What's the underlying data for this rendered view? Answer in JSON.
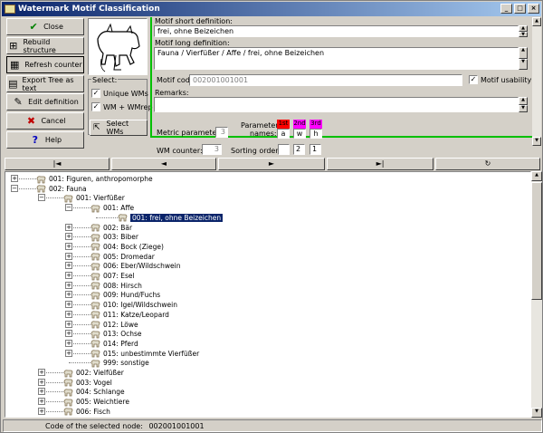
{
  "window": {
    "title": "Watermark Motif Classification"
  },
  "buttons": {
    "close": "Close",
    "rebuild": "Rebuild structure",
    "refresh": "Refresh counter",
    "export": "Export Tree as text",
    "edit": "Edit definition",
    "cancel": "Cancel",
    "help": "Help",
    "select_wms": "Select WMs"
  },
  "select_group": {
    "title": "Select:",
    "unique_wms": "Unique WMs",
    "wm_wmrep": "WM + WMrep"
  },
  "form": {
    "short_label": "Motif short definition:",
    "short_value": "frei, ohne Beizeichen",
    "long_label": "Motif long definition:",
    "long_value": "Fauna / Vierfüßer / Affe / frei, ohne Beizeichen",
    "code_label": "Motif code:",
    "code_value": "002001001001",
    "usability_label": "Motif usability",
    "remarks_label": "Remarks:",
    "metric_label": "Metric parameters:",
    "metric_value": "3",
    "param_names_label_1": "Parameter",
    "param_names_label_2": "names:",
    "wm_counter_label": "WM counter:",
    "wm_counter_value": "3",
    "sorting_label": "Sorting order:",
    "sort_1": "",
    "sort_2": "2",
    "sort_3": "1"
  },
  "params": [
    {
      "label": "1st",
      "name": "a",
      "color": "#ff0000"
    },
    {
      "label": "2nd",
      "name": "w",
      "color": "#ff00ff"
    },
    {
      "label": "3rd",
      "name": "h",
      "color": "#ff00ff"
    }
  ],
  "nav": {
    "first": "|◄",
    "prev": "◄",
    "next": "►",
    "last": "►|",
    "refresh": "↻"
  },
  "tree": [
    {
      "label": "001: Figuren, anthropomorphe",
      "level": 0,
      "exp": "+"
    },
    {
      "label": "002: Fauna",
      "level": 0,
      "exp": "-"
    },
    {
      "label": "001: Vierfüßer",
      "level": 1,
      "exp": "-"
    },
    {
      "label": "001: Affe",
      "level": 2,
      "exp": "-"
    },
    {
      "label": "001: frei, ohne Beizeichen",
      "level": 3,
      "exp": "",
      "selected": true
    },
    {
      "label": "002: Bär",
      "level": 2,
      "exp": "+"
    },
    {
      "label": "003: Biber",
      "level": 2,
      "exp": "+"
    },
    {
      "label": "004: Bock (Ziege)",
      "level": 2,
      "exp": "+"
    },
    {
      "label": "005: Dromedar",
      "level": 2,
      "exp": "+"
    },
    {
      "label": "006: Eber/Wildschwein",
      "level": 2,
      "exp": "+"
    },
    {
      "label": "007: Esel",
      "level": 2,
      "exp": "+"
    },
    {
      "label": "008: Hirsch",
      "level": 2,
      "exp": "+"
    },
    {
      "label": "009: Hund/Fuchs",
      "level": 2,
      "exp": "+"
    },
    {
      "label": "010: Igel/Wildschwein",
      "level": 2,
      "exp": "+"
    },
    {
      "label": "011: Katze/Leopard",
      "level": 2,
      "exp": "+"
    },
    {
      "label": "012: Löwe",
      "level": 2,
      "exp": "+"
    },
    {
      "label": "013: Ochse",
      "level": 2,
      "exp": "+"
    },
    {
      "label": "014: Pferd",
      "level": 2,
      "exp": "+"
    },
    {
      "label": "015: unbestimmte Vierfüßer",
      "level": 2,
      "exp": "+"
    },
    {
      "label": "999: sonstige",
      "level": 2,
      "exp": ""
    },
    {
      "label": "002: Vielfüßer",
      "level": 1,
      "exp": "+"
    },
    {
      "label": "003: Vogel",
      "level": 1,
      "exp": "+"
    },
    {
      "label": "004: Schlange",
      "level": 1,
      "exp": "+"
    },
    {
      "label": "005: Weichtiere",
      "level": 1,
      "exp": "+"
    },
    {
      "label": "006: Fisch",
      "level": 1,
      "exp": "+"
    }
  ],
  "status": {
    "label": "Code of the selected node:",
    "value": "002001001001"
  }
}
